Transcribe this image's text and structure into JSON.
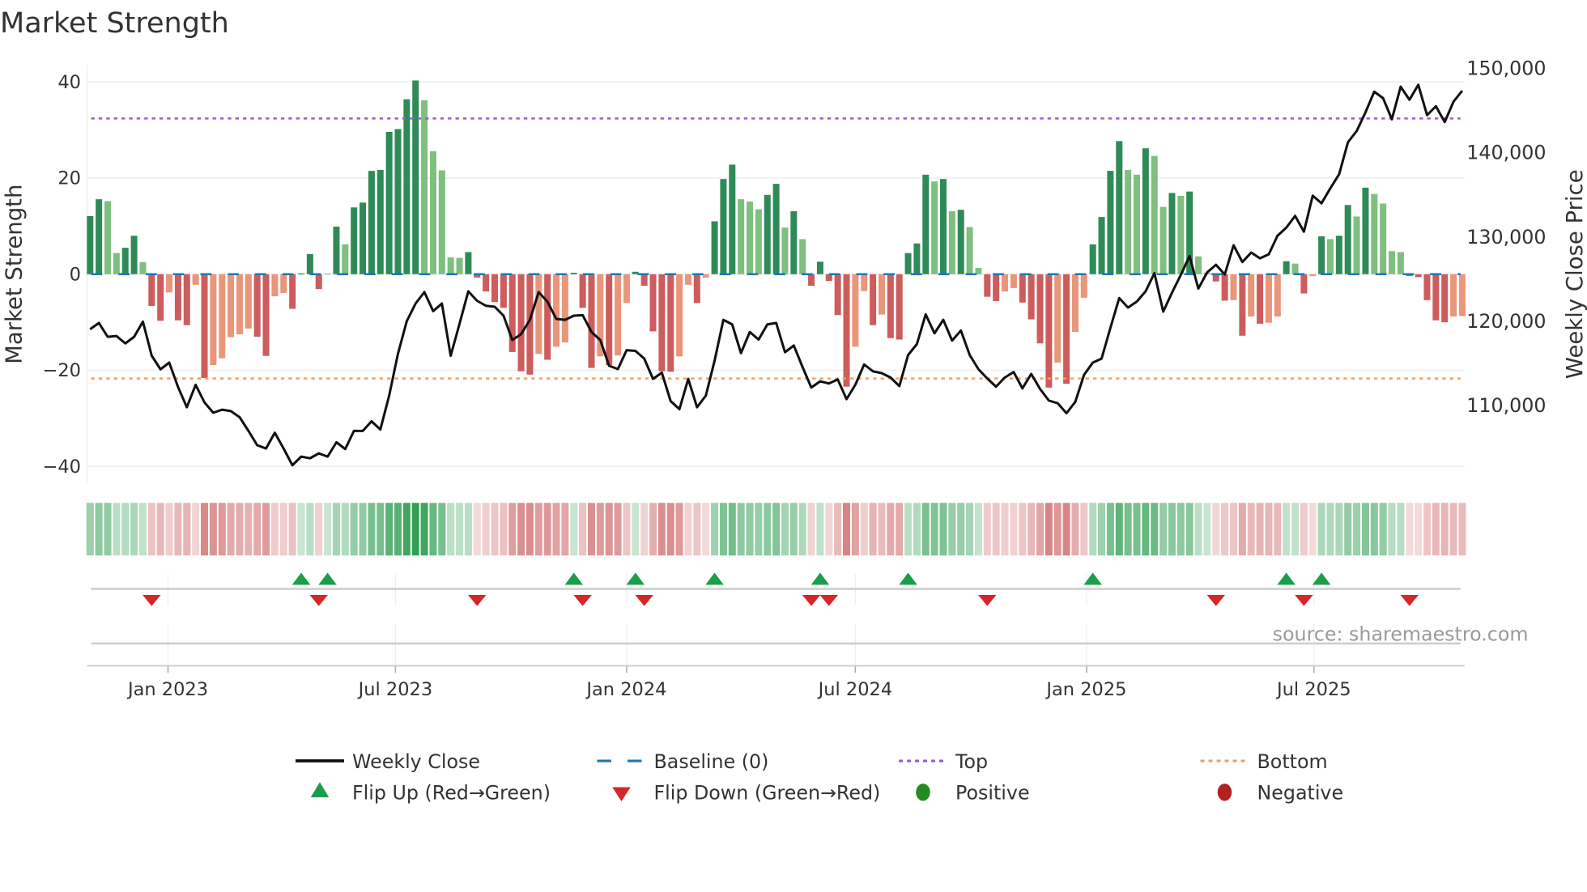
{
  "title": "Market Strength",
  "source": "source: sharemaestro.com",
  "chart_data": {
    "type": "bar",
    "title": "Market Strength",
    "ylabel": "Market Strength",
    "y2label": "Weekly Close Price",
    "ylim": [
      -44,
      42
    ],
    "y2lim": [
      101000,
      151900
    ],
    "yticks": [
      {
        "v": 40,
        "label": "40"
      },
      {
        "v": 20,
        "label": "20"
      },
      {
        "v": 0,
        "label": "0"
      },
      {
        "v": -20,
        "label": "−20"
      },
      {
        "v": -40,
        "label": "−40"
      }
    ],
    "y2ticks": [
      {
        "v": 150000,
        "label": "150,000"
      },
      {
        "v": 140000,
        "label": "140,000"
      },
      {
        "v": 130000,
        "label": "130,000"
      },
      {
        "v": 120000,
        "label": "120,000"
      },
      {
        "v": 110000,
        "label": "110,000"
      }
    ],
    "xticks": [
      {
        "date": "2023-01-01",
        "label": "Jan 2023"
      },
      {
        "date": "2023-07-01",
        "label": "Jul 2023"
      },
      {
        "date": "2024-01-01",
        "label": "Jan 2024"
      },
      {
        "date": "2024-07-01",
        "label": "Jul 2024"
      },
      {
        "date": "2025-01-01",
        "label": "Jan 2025"
      },
      {
        "date": "2025-07-01",
        "label": "Jul 2025"
      }
    ],
    "first_week": "2022-10-31",
    "interval_days": 7,
    "top_level": 32.4,
    "bottom_level": -21.7,
    "baseline": 0,
    "strength": [
      12.1,
      15.6,
      15.2,
      4.4,
      5.5,
      8.0,
      2.5,
      -6.6,
      -9.7,
      -3.8,
      -9.6,
      -10.6,
      -2.2,
      -21.6,
      -18.9,
      -17.5,
      -13.1,
      -12.5,
      -11.3,
      -13.0,
      -17.0,
      -4.6,
      -3.9,
      -7.2,
      0.2,
      4.2,
      -3.1,
      0.1,
      9.9,
      6.2,
      13.9,
      14.9,
      21.5,
      21.7,
      29.6,
      30.2,
      36.4,
      40.3,
      36.2,
      25.6,
      21.6,
      3.5,
      3.4,
      4.6,
      -0.7,
      -3.6,
      -5.8,
      -7.0,
      -16.2,
      -20.2,
      -20.9,
      -16.6,
      -17.8,
      -15.1,
      -14.2,
      0.3,
      -7.0,
      -19.5,
      -17.1,
      -18.9,
      -16.9,
      -6.0,
      0.5,
      -2.4,
      -11.9,
      -20.2,
      -20.3,
      -17.1,
      -2.2,
      -6.0,
      -0.7,
      11.0,
      19.8,
      22.8,
      15.6,
      15.1,
      13.5,
      16.5,
      18.8,
      9.7,
      13.1,
      7.3,
      -2.4,
      2.6,
      -1.4,
      -8.5,
      -23.4,
      -15.1,
      -3.5,
      -10.6,
      -8.4,
      -13.3,
      -13.6,
      4.4,
      6.4,
      20.7,
      19.3,
      19.8,
      13.1,
      13.4,
      9.8,
      1.3,
      -4.7,
      -5.6,
      -3.6,
      -2.9,
      -5.9,
      -9.4,
      -14.4,
      -23.6,
      -18.4,
      -22.8,
      -12.0,
      -4.9,
      6.2,
      11.9,
      21.5,
      27.7,
      21.7,
      20.7,
      26.2,
      24.6,
      14.0,
      16.9,
      16.3,
      17.2,
      3.7,
      0.3,
      -1.5,
      -5.5,
      -5.4,
      -12.8,
      -8.8,
      -10.3,
      -10.1,
      -8.8,
      2.7,
      2.2,
      -4.0,
      -0.4,
      7.9,
      7.3,
      8.0,
      14.4,
      12.0,
      18.0,
      16.7,
      14.7,
      4.8,
      4.6,
      -0.4,
      -0.6,
      -5.4,
      -9.6,
      -10.0,
      -8.8,
      -8.7
    ],
    "weekly_close": [
      118980,
      119720,
      118080,
      118170,
      117300,
      118080,
      119880,
      115830,
      114220,
      115020,
      112130,
      109720,
      112390,
      110300,
      109080,
      109430,
      109270,
      108530,
      106920,
      105220,
      104830,
      106700,
      104830,
      102840,
      103870,
      103670,
      104250,
      103870,
      105570,
      104770,
      106920,
      106920,
      108050,
      107080,
      111100,
      116080,
      119940,
      122030,
      123380,
      121130,
      122030,
      115830,
      119620,
      123480,
      122350,
      121770,
      121650,
      120590,
      117690,
      118400,
      120100,
      123380,
      122260,
      120200,
      120100,
      120590,
      120650,
      118660,
      117690,
      114640,
      114250,
      116500,
      116410,
      115500,
      113090,
      113830,
      110460,
      109490,
      113090,
      109720,
      111100,
      115280,
      120100,
      119560,
      116150,
      118660,
      117760,
      119560,
      119720,
      116250,
      117050,
      114480,
      112070,
      112800,
      112550,
      113030,
      110680,
      112390,
      114800,
      113990,
      113770,
      113250,
      112230,
      115920,
      117210,
      120750,
      118500,
      120100,
      117630,
      118820,
      115920,
      114220,
      113130,
      112160,
      113250,
      113900,
      111970,
      113670,
      111900,
      110520,
      110200,
      109010,
      110360,
      113580,
      115020,
      115500,
      119140,
      122680,
      121550,
      122260,
      123480,
      125630,
      121070,
      123320,
      125410,
      127660,
      123800,
      125730,
      126630,
      125470,
      128940,
      126950,
      128080,
      127400,
      127880,
      130070,
      131030,
      132420,
      130550,
      134830,
      133930,
      135700,
      137370,
      141160,
      142510,
      144700,
      147170,
      146400,
      143890,
      147750,
      146210,
      147980,
      144380,
      145440,
      143570,
      145980,
      147270
    ],
    "legend": [
      {
        "key": "close",
        "label": "Weekly Close"
      },
      {
        "key": "baseline",
        "label": "Baseline (0)"
      },
      {
        "key": "top",
        "label": "Top"
      },
      {
        "key": "bottom",
        "label": "Bottom"
      },
      {
        "key": "flip_up",
        "label": "Flip Up (Red→Green)"
      },
      {
        "key": "flip_down",
        "label": "Flip Down (Green→Red)"
      },
      {
        "key": "positive",
        "label": "Positive"
      },
      {
        "key": "negative",
        "label": "Negative"
      }
    ],
    "legend_placement": "bottom",
    "grid": true
  },
  "colors": {
    "pos_rising": "#2e8b57",
    "pos_falling": "#7fbf7f",
    "neg_falling": "#cd5c5c",
    "neg_rising": "#e9967a",
    "close": "#111111",
    "baseline": "#1f77b4",
    "top": "#9b59d6",
    "bottom": "#f0a060",
    "flip_up": "#1a9e4a",
    "flip_down": "#d62728",
    "positive": "#228b22",
    "negative": "#b22222",
    "grid": "#eceef2",
    "axis": "#cccccc"
  }
}
